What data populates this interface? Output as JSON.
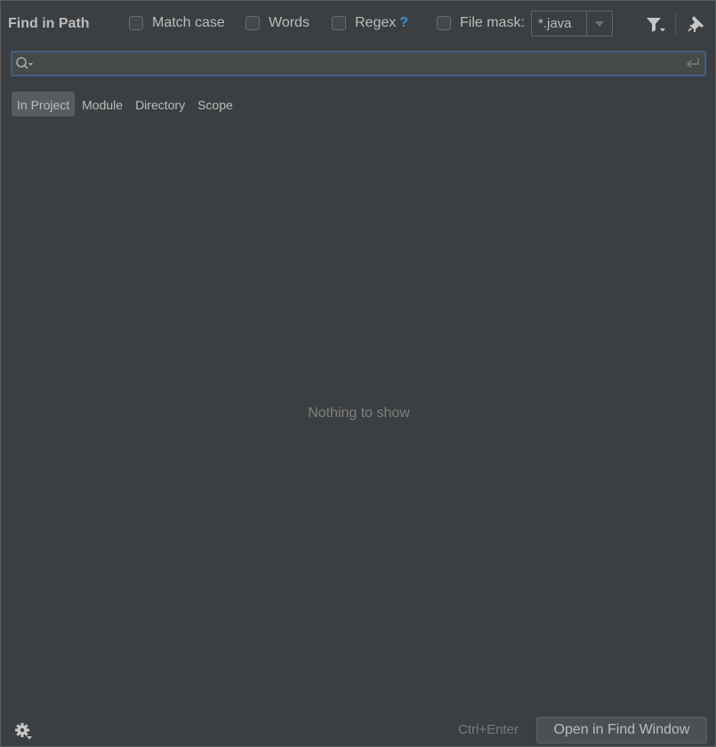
{
  "header": {
    "title": "Find in Path",
    "options": {
      "match_case": {
        "label": "Match case",
        "checked": false
      },
      "words": {
        "label": "Words",
        "checked": false
      },
      "regex": {
        "label": "Regex",
        "help": "?",
        "checked": false
      },
      "file_mask": {
        "label": "File mask:",
        "checked": false,
        "value": "*.java"
      }
    },
    "icons": {
      "filter": "filter-icon",
      "pin": "pin-icon"
    }
  },
  "search": {
    "value": "",
    "placeholder": ""
  },
  "scopes": {
    "in_project": "In Project",
    "module": "Module",
    "directory": "Directory",
    "scope": "Scope",
    "selected": "In Project"
  },
  "results": {
    "empty_text": "Nothing to show"
  },
  "footer": {
    "shortcut": "Ctrl+Enter",
    "open_button": "Open in Find Window"
  },
  "colors": {
    "background": "#3c3f41",
    "focus_border": "#3d6185",
    "help_blue": "#3d8fd6",
    "selected_scope": "#595c5f"
  }
}
